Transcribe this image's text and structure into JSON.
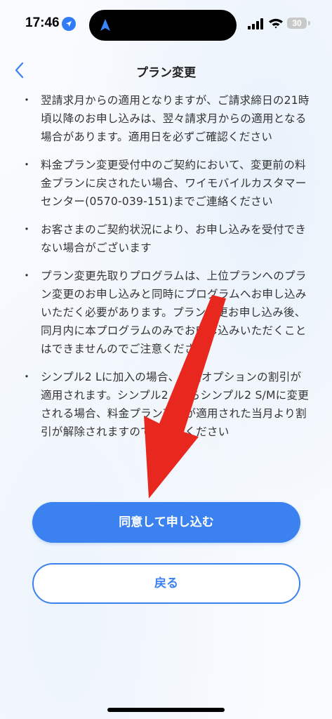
{
  "status_bar": {
    "time": "17:46",
    "battery": "30"
  },
  "nav": {
    "title": "プラン変更"
  },
  "notes": [
    {
      "bullet": "・",
      "text": "翌請求月からの適用となりますが、ご請求締日の21時頃以降のお申し込みは、翌々請求月からの適用となる場合があります。適用日を必ずご確認ください"
    },
    {
      "bullet": "・",
      "text": "料金プラン変更受付中のご契約において、変更前の料金プランに戻されたい場合、ワイモバイルカスタマーセンター(0570-039-151)までご連絡ください"
    },
    {
      "bullet": "・",
      "text": "お客さまのご契約状況により、お申し込みを受付できない場合がございます"
    },
    {
      "bullet": "・",
      "text": "プラン変更先取りプログラムは、上位プランへのプラン変更のお申し込みと同時にプログラムへお申し込みいただく必要があります。プラン変更お申し込み後、同月内に本プログラムのみでお申し込みいただくことはできませんのでご注意ください"
    },
    {
      "bullet": "・",
      "text": "シンプル2 Lに加入の場合、通話オプションの割引が適用されます。シンプル2 Lからシンプル2 S/Mに変更される場合、料金プラン変更が適用された当月より割引が解除されますのでご注意ください"
    }
  ],
  "buttons": {
    "agree": "同意して申し込む",
    "back": "戻る"
  },
  "colors": {
    "accent": "#3b82f0",
    "annotation_arrow": "#e8281e"
  },
  "icons": [
    "location-arrow-icon",
    "navigation-arrow-icon",
    "signal-icon",
    "wifi-icon",
    "battery-icon",
    "back-chevron-icon"
  ]
}
